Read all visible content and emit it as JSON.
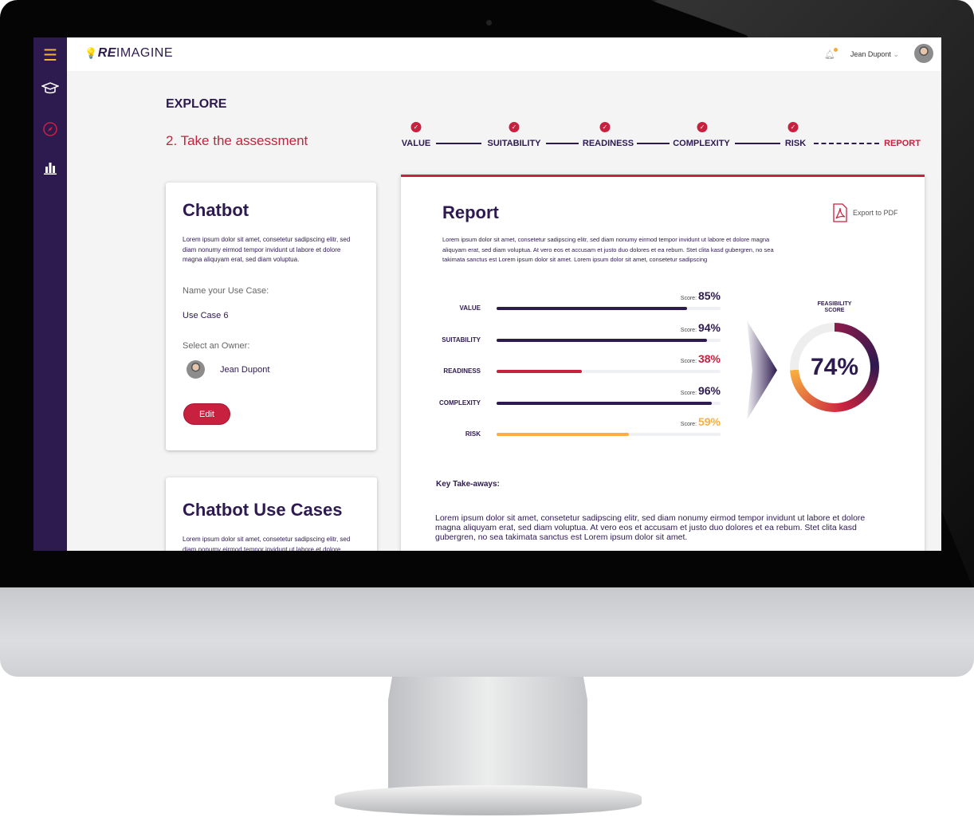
{
  "app": {
    "logo_bold": "RE",
    "logo_rest": "IMAGINE",
    "user_name": "Jean Dupont"
  },
  "sidebar": {
    "items": [
      {
        "icon": "menu-icon"
      },
      {
        "icon": "graduation-cap-icon"
      },
      {
        "icon": "compass-icon",
        "active": true
      },
      {
        "icon": "bar-chart-icon"
      }
    ]
  },
  "page": {
    "section": "EXPLORE",
    "subtitle": "2. Take the assessment"
  },
  "steps": [
    {
      "label": "VALUE",
      "done": true
    },
    {
      "label": "SUITABILITY",
      "done": true
    },
    {
      "label": "READINESS",
      "done": true
    },
    {
      "label": "COMPLEXITY",
      "done": true
    },
    {
      "label": "RISK",
      "done": true
    },
    {
      "label": "REPORT",
      "current": true
    }
  ],
  "card": {
    "title": "Chatbot",
    "description": "Lorem ipsum dolor sit amet, consetetur sadipscing elitr, sed diam nonumy eirmod tempor invidunt ut labore et dolore magna aliquyam erat, sed diam voluptua.",
    "name_label": "Name your Use Case:",
    "name_value": "Use Case 6",
    "owner_label": "Select an Owner:",
    "owner_name": "Jean Dupont",
    "edit_label": "Edit"
  },
  "card2": {
    "title": "Chatbot Use Cases",
    "description": "Lorem ipsum dolor sit amet, consetetur sadipscing elitr, sed diam nonumy eirmod tempor invidunt ut labore et dolore"
  },
  "report": {
    "title": "Report",
    "export_label": "Export to PDF",
    "description": "Lorem ipsum dolor sit amet, consetetur sadipscing elitr, sed diam nonumy eirmod tempor invidunt ut labore et dolore magna aliquyam erat, sed diam voluptua. At vero eos et accusam et justo duo dolores et ea rebum. Stet clita kasd gubergren, no sea takimata sanctus est Lorem ipsum dolor sit amet. Lorem ipsum dolor sit amet, consetetur sadipscing",
    "score_prefix": "Score:",
    "scores": [
      {
        "label": "VALUE",
        "value": 85,
        "text": "85%",
        "color": "#2d1a4f"
      },
      {
        "label": "SUITABILITY",
        "value": 94,
        "text": "94%",
        "color": "#2d1a4f"
      },
      {
        "label": "READINESS",
        "value": 38,
        "text": "38%",
        "color": "#c8203f"
      },
      {
        "label": "COMPLEXITY",
        "value": 96,
        "text": "96%",
        "color": "#2d1a4f"
      },
      {
        "label": "RISK",
        "value": 59,
        "text": "59%",
        "color": "#f9b040"
      }
    ],
    "feasibility_label_1": "FEASIBILITY",
    "feasibility_label_2": "SCORE",
    "feasibility_value": 74,
    "feasibility_text": "74%",
    "takeaways_title": "Key Take-aways:",
    "takeaways_text": "Lorem ipsum dolor sit amet, consetetur sadipscing elitr, sed diam nonumy eirmod tempor invidunt ut labore et dolore magna aliquyam erat, sed diam voluptua. At vero eos et accusam et justo duo dolores et ea rebum. Stet clita kasd gubergren, no sea takimata sanctus est Lorem ipsum dolor sit amet."
  },
  "colors": {
    "primary": "#2d1a4f",
    "accent": "#c8203f",
    "warning": "#f9b040",
    "notification": "#f9a83a"
  }
}
